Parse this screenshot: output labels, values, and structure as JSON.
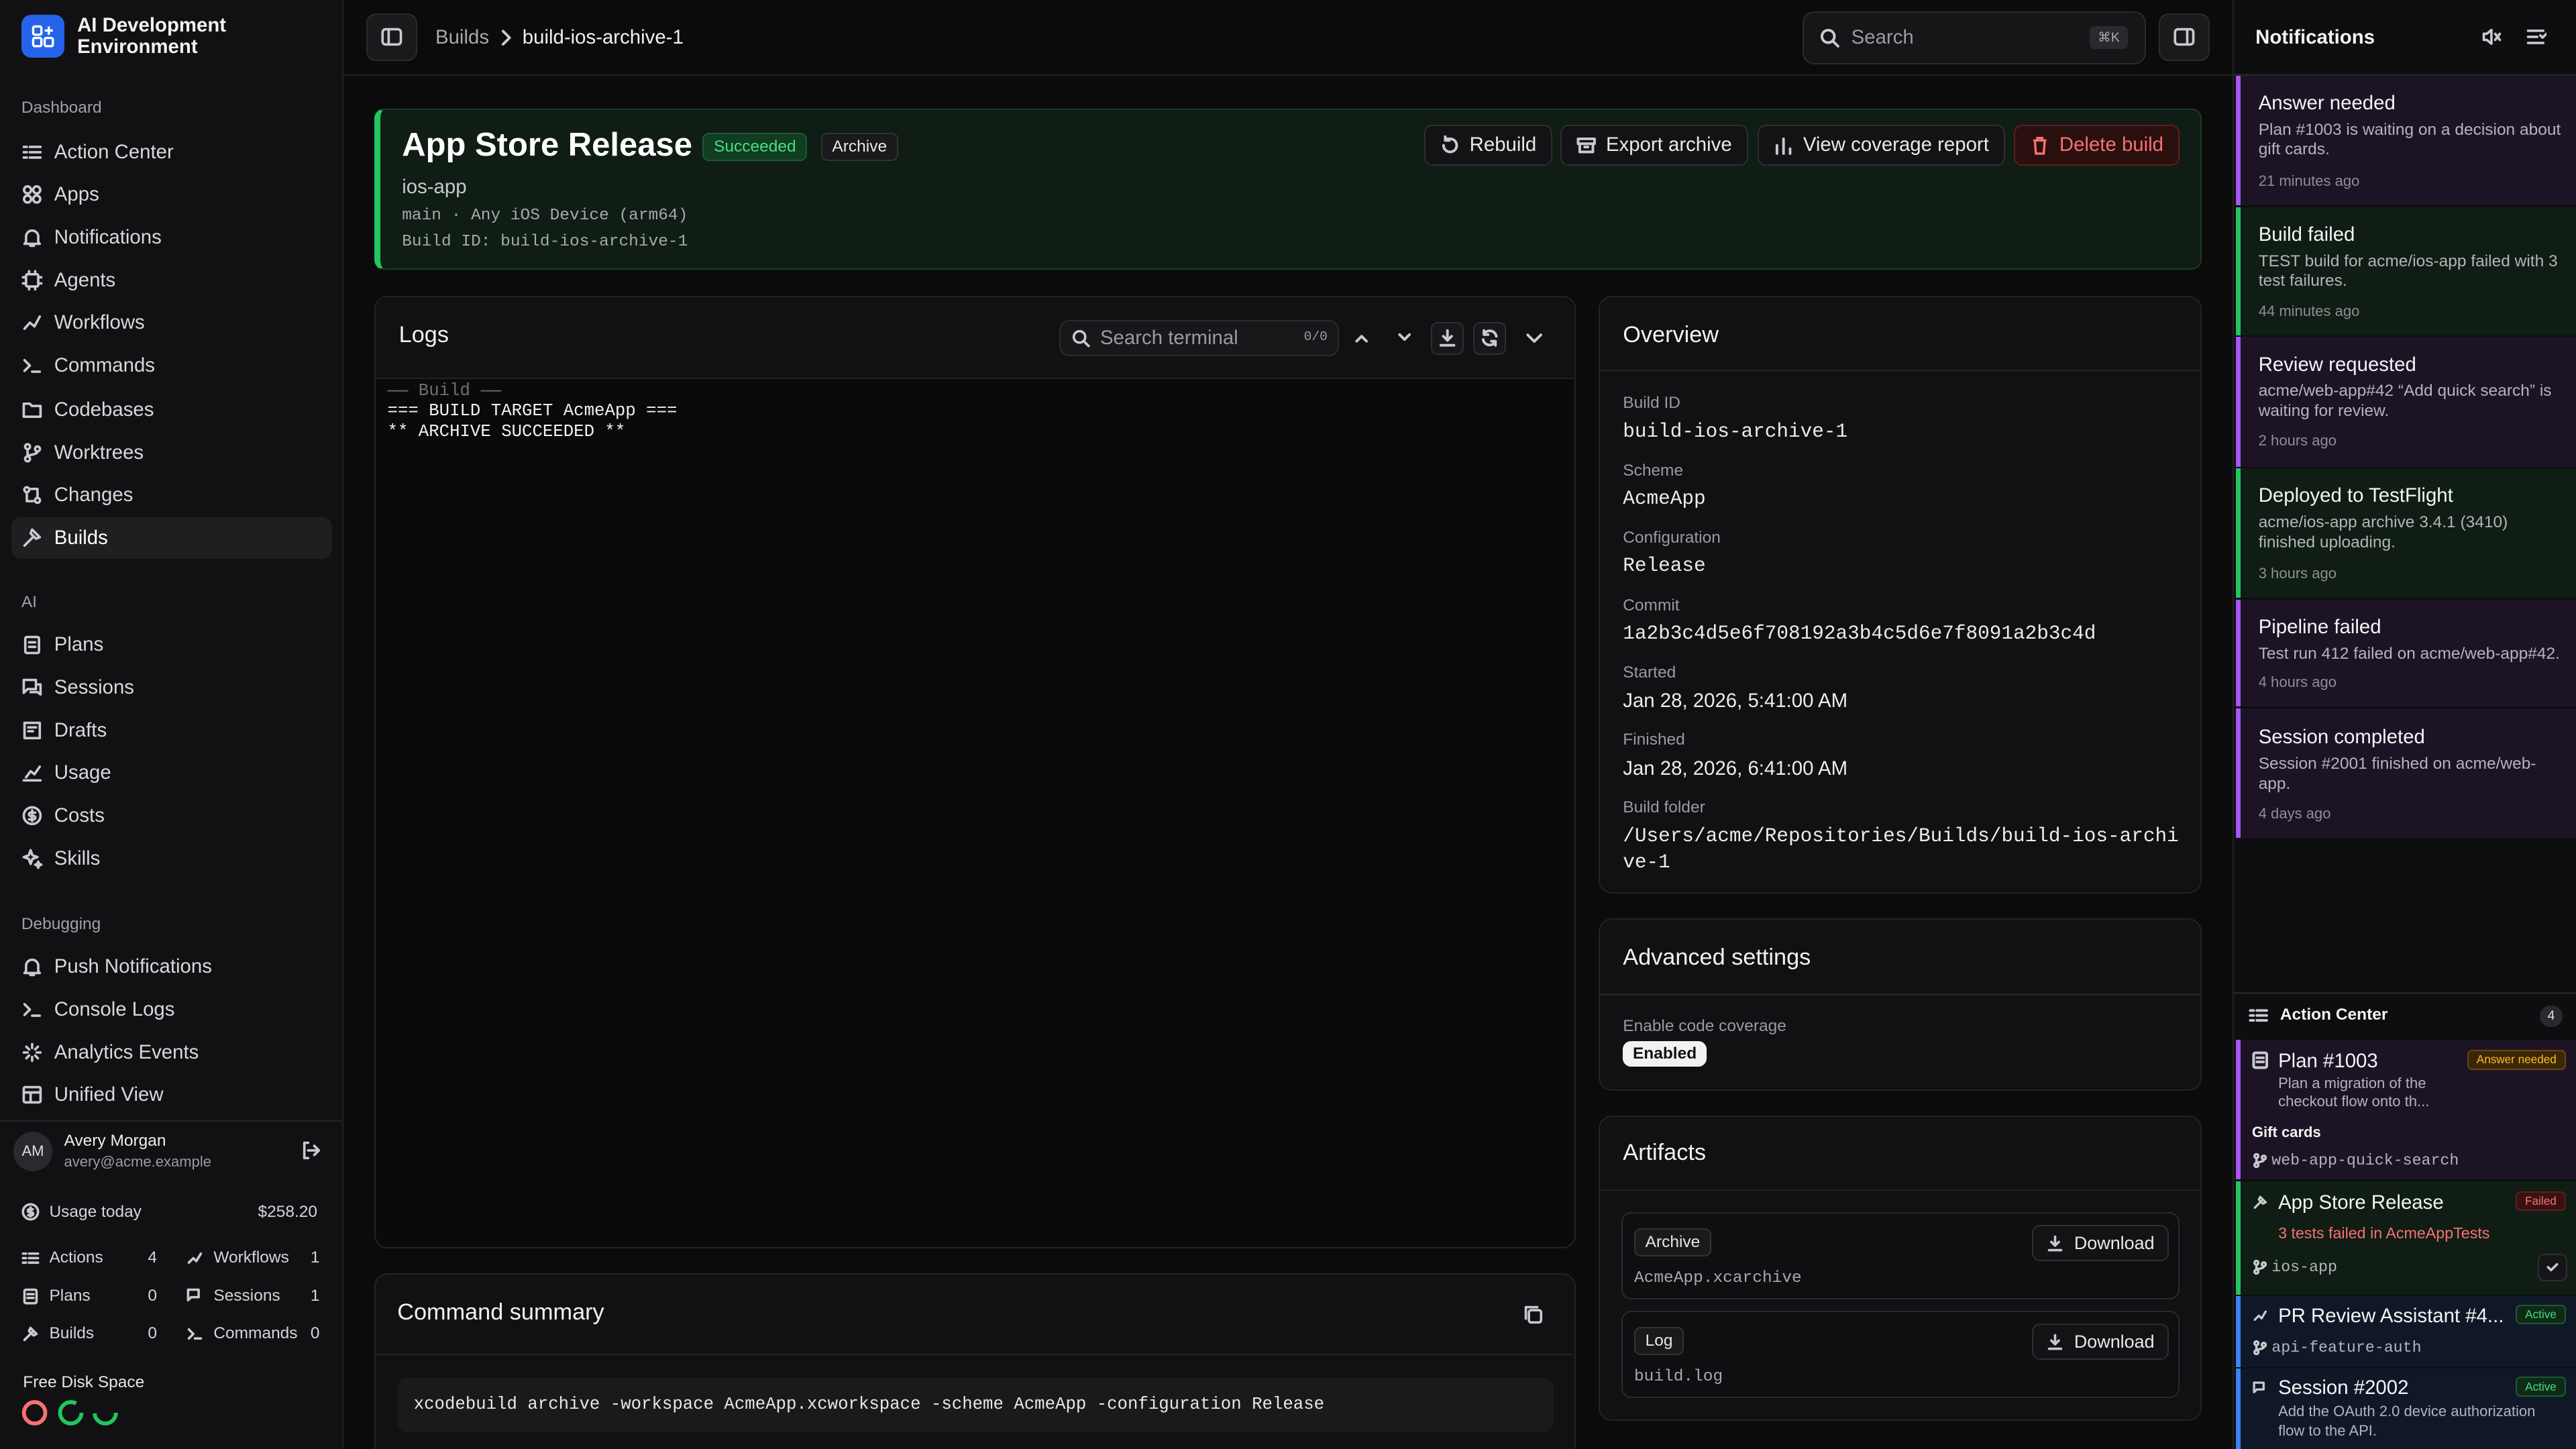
{
  "app": {
    "title": "AI Development Environment"
  },
  "sidebar": {
    "sections": [
      {
        "label": "Dashboard",
        "items": [
          {
            "label": "Action Center",
            "icon": "list-check-icon"
          },
          {
            "label": "Apps",
            "icon": "apps-icon"
          },
          {
            "label": "Notifications",
            "icon": "bell-icon"
          },
          {
            "label": "Agents",
            "icon": "cpu-icon"
          },
          {
            "label": "Workflows",
            "icon": "workflow-icon"
          },
          {
            "label": "Commands",
            "icon": "terminal-icon"
          },
          {
            "label": "Codebases",
            "icon": "folder-icon"
          },
          {
            "label": "Worktrees",
            "icon": "branch-icon"
          },
          {
            "label": "Changes",
            "icon": "git-compare-icon"
          },
          {
            "label": "Builds",
            "icon": "hammer-icon",
            "active": true
          }
        ]
      },
      {
        "label": "AI",
        "items": [
          {
            "label": "Plans",
            "icon": "clipboard-icon"
          },
          {
            "label": "Sessions",
            "icon": "messages-icon"
          },
          {
            "label": "Drafts",
            "icon": "draft-icon"
          },
          {
            "label": "Usage",
            "icon": "chart-icon"
          },
          {
            "label": "Costs",
            "icon": "dollar-icon"
          },
          {
            "label": "Skills",
            "icon": "sparkles-icon"
          }
        ]
      },
      {
        "label": "Debugging",
        "items": [
          {
            "label": "Push Notifications",
            "icon": "bell-icon"
          },
          {
            "label": "Console Logs",
            "icon": "terminal-icon"
          },
          {
            "label": "Analytics Events",
            "icon": "activity-icon"
          },
          {
            "label": "Unified View",
            "icon": "layout-icon"
          }
        ]
      }
    ],
    "user": {
      "initials": "AM",
      "name": "Avery Morgan",
      "email": "avery@acme.example"
    },
    "usage": {
      "label": "Usage today",
      "value": "$258.20"
    },
    "stats": [
      {
        "label": "Actions",
        "value": "4"
      },
      {
        "label": "Workflows",
        "value": "1"
      },
      {
        "label": "Plans",
        "value": "0"
      },
      {
        "label": "Sessions",
        "value": "1"
      },
      {
        "label": "Builds",
        "value": "0"
      },
      {
        "label": "Commands",
        "value": "0"
      }
    ],
    "disk": {
      "label": "Free Disk Space",
      "colors": [
        "#f87171",
        "#22c55e",
        "#22c55e"
      ]
    }
  },
  "topbar": {
    "breadcrumb": [
      "Builds",
      "build-ios-archive-1"
    ],
    "search_placeholder": "Search",
    "search_shortcut": "⌘K"
  },
  "build": {
    "title": "App Store Release",
    "status": "Succeeded",
    "kind": "Archive",
    "app": "ios-app",
    "meta": "main · Any iOS Device (arm64)",
    "build_id_line": "Build ID: build-ios-archive-1",
    "actions": {
      "rebuild": "Rebuild",
      "export": "Export archive",
      "coverage": "View coverage report",
      "delete": "Delete build"
    }
  },
  "logs": {
    "title": "Logs",
    "search_placeholder": "Search terminal",
    "match_count": "0/0",
    "lines": [
      "—— Build ——",
      "=== BUILD TARGET AcmeApp ===",
      "** ARCHIVE SUCCEEDED **"
    ]
  },
  "command_summary": {
    "title": "Command summary",
    "command": "xcodebuild archive -workspace AcmeApp.xcworkspace -scheme AcmeApp -configuration Release"
  },
  "overview": {
    "title": "Overview",
    "fields": [
      {
        "label": "Build ID",
        "value": "build-ios-archive-1"
      },
      {
        "label": "Scheme",
        "value": "AcmeApp"
      },
      {
        "label": "Configuration",
        "value": "Release"
      },
      {
        "label": "Commit",
        "value": "1a2b3c4d5e6f708192a3b4c5d6e7f8091a2b3c4d"
      },
      {
        "label": "Started",
        "value": "Jan 28, 2026, 5:41:00 AM"
      },
      {
        "label": "Finished",
        "value": "Jan 28, 2026, 6:41:00 AM"
      },
      {
        "label": "Build folder",
        "value": "/Users/acme/Repositories/Builds/build-ios-archive-1"
      }
    ]
  },
  "advanced": {
    "title": "Advanced settings",
    "coverage_label": "Enable code coverage",
    "coverage_value": "Enabled"
  },
  "artifacts": {
    "title": "Artifacts",
    "items": [
      {
        "type": "Archive",
        "file": "AcmeApp.xcarchive",
        "action": "Download"
      },
      {
        "type": "Log",
        "file": "build.log",
        "action": "Download"
      }
    ]
  },
  "notifications": {
    "title": "Notifications",
    "items": [
      {
        "title": "Answer needed",
        "body": "Plan #1003 is waiting on a decision about gift cards.",
        "time": "21 minutes ago",
        "color": "#a855f7"
      },
      {
        "title": "Build failed",
        "body": "TEST build for acme/ios-app failed with 3 test failures.",
        "time": "44 minutes ago",
        "color": "#22c55e"
      },
      {
        "title": "Review requested",
        "body": "acme/web-app#42 “Add quick search” is waiting for review.",
        "time": "2 hours ago",
        "color": "#a855f7"
      },
      {
        "title": "Deployed to TestFlight",
        "body": "acme/ios-app archive 3.4.1 (3410) finished uploading.",
        "time": "3 hours ago",
        "color": "#22c55e"
      },
      {
        "title": "Pipeline failed",
        "body": "Test run 412 failed on acme/web-app#42.",
        "time": "4 hours ago",
        "color": "#a855f7"
      },
      {
        "title": "Session completed",
        "body": "Session #2001 finished on acme/web-app.",
        "time": "4 days ago",
        "color": "#a855f7"
      }
    ]
  },
  "action_center": {
    "title": "Action Center",
    "count": "4",
    "items": [
      {
        "title": "Plan #1003",
        "badge": "Answer needed",
        "body": "Plan a migration of the checkout flow onto th...",
        "sub": "Gift cards",
        "ref": "web-app-quick-search"
      },
      {
        "title": "App Store Release",
        "badge": "Failed",
        "body": "3 tests failed in AcmeAppTests",
        "ref": "ios-app"
      },
      {
        "title": "PR Review Assistant #4...",
        "badge": "Active",
        "ref": "api-feature-auth"
      },
      {
        "title": "Session #2002",
        "badge": "Active",
        "body": "Add the OAuth 2.0 device authorization flow to the API."
      }
    ]
  }
}
